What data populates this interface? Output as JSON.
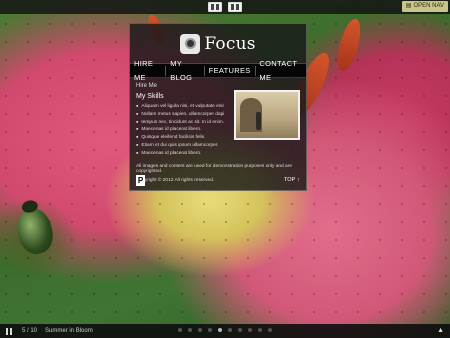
{
  "topbar": {
    "open_nav_label": "OPEN NAV",
    "view_buttons": [
      "single-view",
      "double-view"
    ]
  },
  "logo": {
    "text": "Focus",
    "icon": "camera-icon"
  },
  "nav": {
    "items": [
      {
        "label": "HIRE ME"
      },
      {
        "label": "MY BLOG"
      },
      {
        "label": "FEATURES"
      },
      {
        "label": "CONTACT ME"
      }
    ]
  },
  "content": {
    "hire_heading": "Hire Me",
    "skills_heading": "My Skills",
    "skills": [
      "Aliquam vel ligula nisi, et vulputate enim.",
      "Nullam metus sapien, ullamcorper dapibus.",
      "tempus nec, tincidunt ac sit. In id enim.",
      "Maecenas id placerat libero.",
      "Quisque eleifend facilisis felis.",
      "Etiam et dui quis ipsum ullamcorper.",
      "Maecenas id placerat libero."
    ],
    "disclaimer": "All images and content are used for demonstration purposes only and are copyrighted.",
    "copyright": "Copyright © 2012 All rights reserved.",
    "top_link": "TOP"
  },
  "bottombar": {
    "counter": "5 / 10",
    "caption": "Summer in Bloom",
    "total_dots": 10,
    "active_dot": 4
  },
  "colors": {
    "panel_bg": "#191919",
    "open_nav_bg": "#c9c58a"
  }
}
